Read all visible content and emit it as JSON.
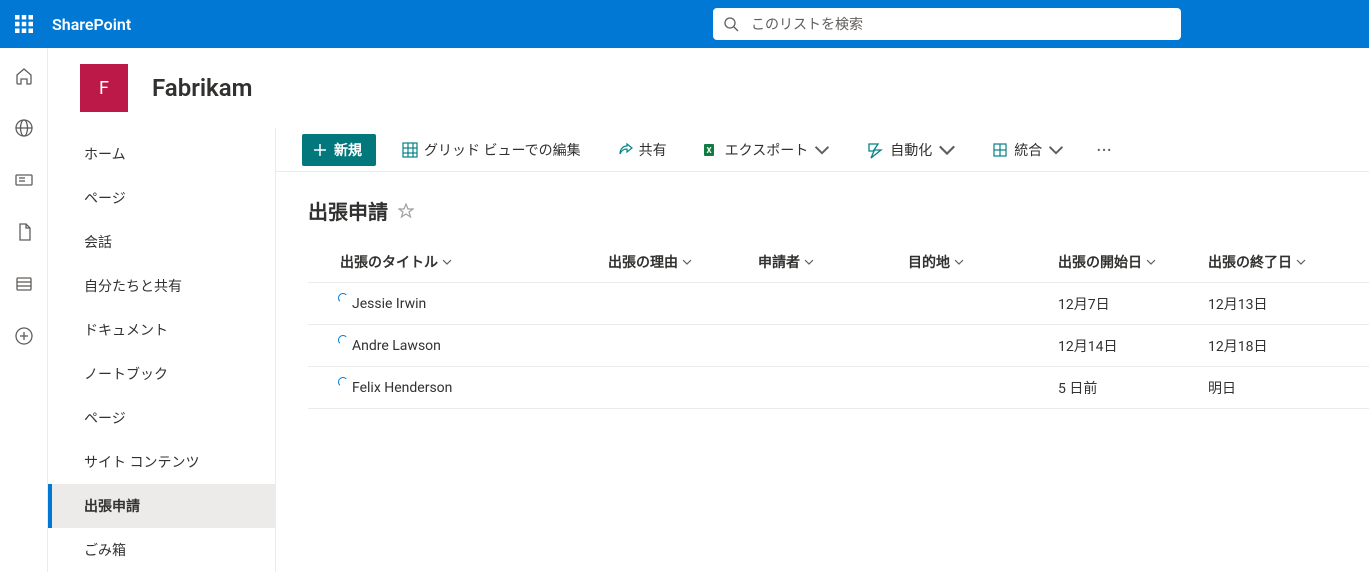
{
  "suite": {
    "brand": "SharePoint",
    "search_placeholder": "このリストを検索"
  },
  "site": {
    "logo_letter": "F",
    "title": "Fabrikam"
  },
  "nav": {
    "items": [
      {
        "label": "ホーム"
      },
      {
        "label": "ページ"
      },
      {
        "label": "会話"
      },
      {
        "label": "自分たちと共有"
      },
      {
        "label": "ドキュメント"
      },
      {
        "label": "ノートブック"
      },
      {
        "label": "ページ"
      },
      {
        "label": "サイト コンテンツ"
      },
      {
        "label": "出張申請"
      },
      {
        "label": "ごみ箱"
      }
    ],
    "selected_index": 8
  },
  "commands": {
    "new": "新規",
    "grid_edit": "グリッド ビューでの編集",
    "share": "共有",
    "export": "エクスポート",
    "automate": "自動化",
    "integrate": "統合"
  },
  "list": {
    "title": "出張申請",
    "columns": [
      "出張のタイトル",
      "出張の理由",
      "申請者",
      "目的地",
      "出張の開始日",
      "出張の終了日"
    ],
    "rows": [
      {
        "title": "Jessie Irwin",
        "reason": "",
        "applicant": "",
        "dest": "",
        "start": "12月7日",
        "end": "12月13日"
      },
      {
        "title": "Andre Lawson",
        "reason": "",
        "applicant": "",
        "dest": "",
        "start": "12月14日",
        "end": "12月18日"
      },
      {
        "title": "Felix Henderson",
        "reason": "",
        "applicant": "",
        "dest": "",
        "start": "5 日前",
        "end": "明日"
      }
    ]
  }
}
